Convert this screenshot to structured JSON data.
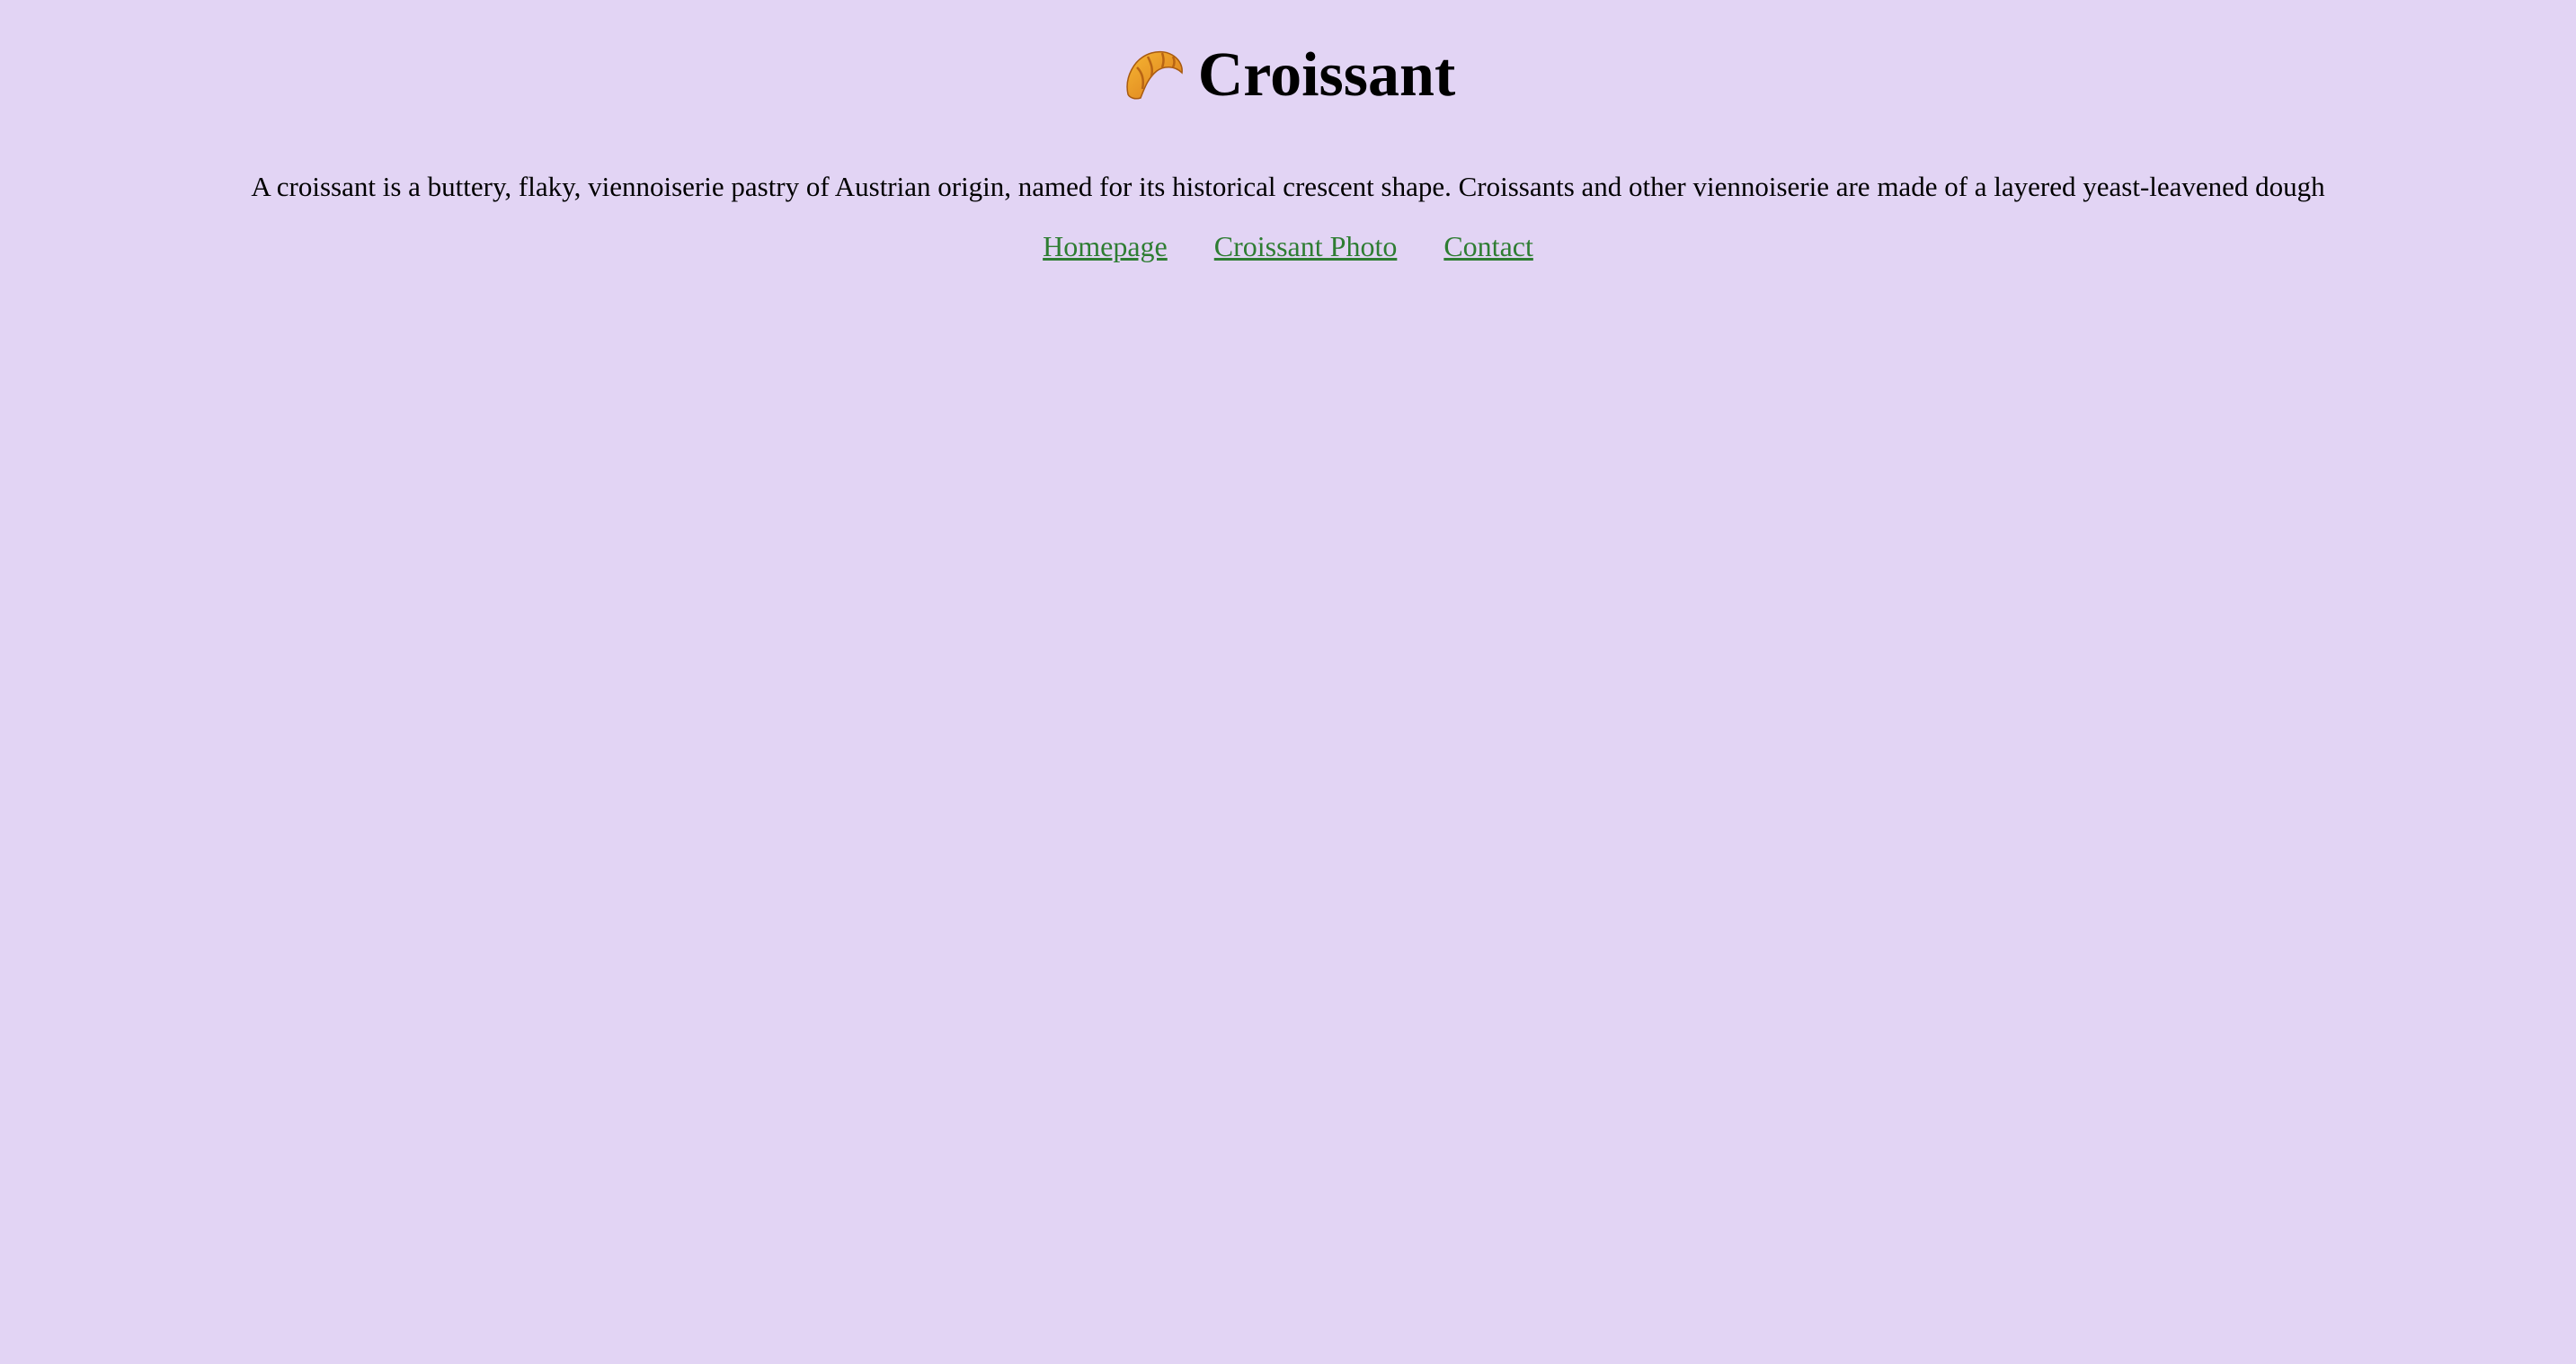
{
  "header": {
    "icon": "croissant-icon",
    "title": "Croissant"
  },
  "main": {
    "description": "A croissant is a buttery, flaky, viennoiserie pastry of Austrian origin, named for its historical crescent shape. Croissants and other viennoiserie are made of a layered yeast-leavened dough"
  },
  "nav": {
    "links": [
      {
        "label": "Homepage"
      },
      {
        "label": "Croissant Photo"
      },
      {
        "label": "Contact"
      }
    ]
  },
  "colors": {
    "background": "#e2d4f4",
    "link": "#2e7d32",
    "text": "#000000"
  }
}
